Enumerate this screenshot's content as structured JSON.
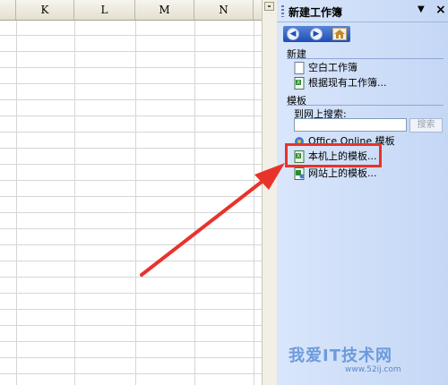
{
  "sheet": {
    "columns": [
      "K",
      "L",
      "M",
      "N"
    ]
  },
  "taskpane": {
    "title": "新建工作簿",
    "menu_glyph": "▼",
    "close_glyph": "×",
    "nav": {
      "back_icon": "back-arrow-icon",
      "forward_icon": "forward-arrow-icon",
      "home_icon": "home-icon"
    },
    "new_section": {
      "title": "新建",
      "items": [
        {
          "label": "空白工作簿",
          "icon": "blank-workbook-icon"
        },
        {
          "label": "根据现有工作簿...",
          "icon": "existing-workbook-icon"
        }
      ]
    },
    "template_section": {
      "title": "模板",
      "search_label": "到网上搜索:",
      "search_value": "",
      "search_button": "搜索",
      "items": [
        {
          "label": "Office Online 模板",
          "icon": "office-online-icon"
        },
        {
          "label": "本机上的模板...",
          "icon": "local-template-icon"
        },
        {
          "label": "网站上的模板...",
          "icon": "website-template-icon"
        }
      ]
    }
  },
  "annotation": {
    "highlight_color": "#e8332c",
    "arrow_color": "#e8332c"
  },
  "watermark": {
    "text": "我爱IT技术网",
    "sub": "www.52ij.com"
  }
}
